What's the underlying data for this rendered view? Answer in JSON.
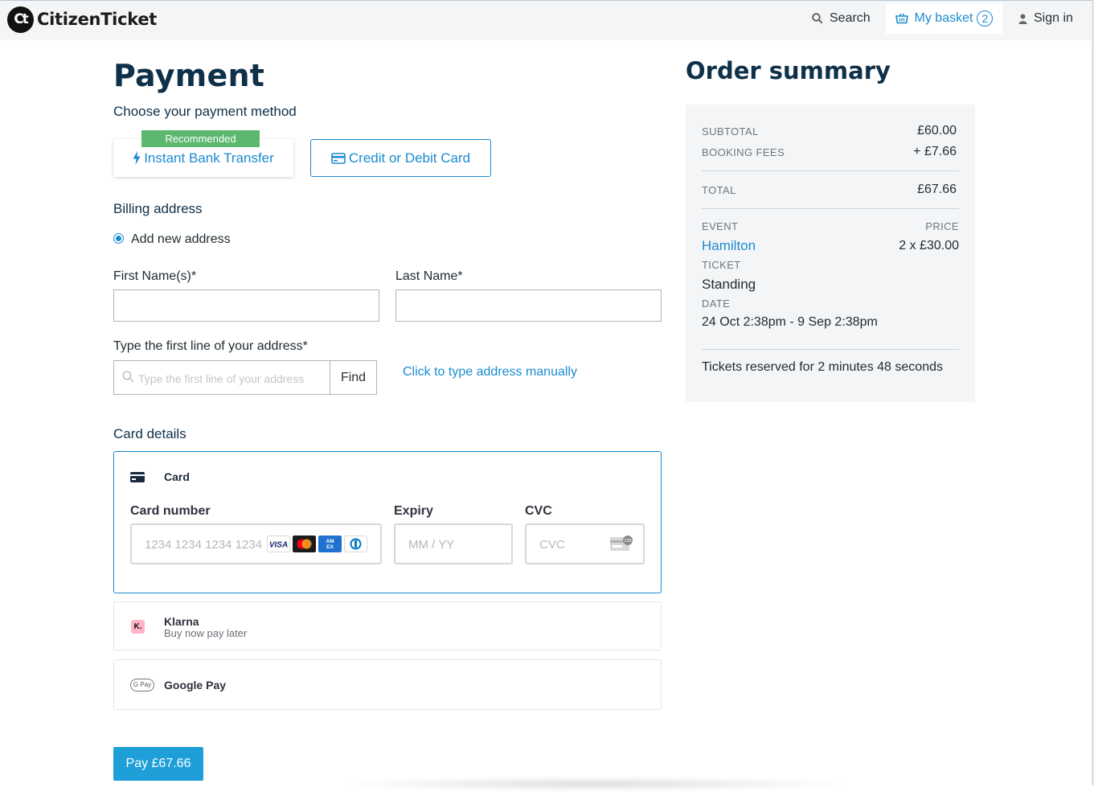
{
  "header": {
    "logo_mark": "Ct",
    "logo_text": "CitizenTicket",
    "search_label": "Search",
    "basket_label": "My basket",
    "basket_count": "2",
    "signin_label": "Sign in"
  },
  "payment": {
    "title": "Payment",
    "choose_method": "Choose your payment method",
    "recommended_badge": "Recommended",
    "bank_transfer_label": "Instant Bank Transfer",
    "card_label": "Credit or Debit Card"
  },
  "billing": {
    "heading": "Billing address",
    "radio_label": "Add new address",
    "first_name_label": "First Name(s)*",
    "last_name_label": "Last Name*",
    "address_label": "Type the first line of your address*",
    "address_placeholder": "Type the first line of your address",
    "find_label": "Find",
    "manual_link": "Click to type address manually"
  },
  "card_details": {
    "heading": "Card details",
    "card_tab": "Card",
    "number_label": "Card number",
    "number_placeholder": "1234 1234 1234 1234",
    "expiry_label": "Expiry",
    "expiry_placeholder": "MM / YY",
    "cvc_label": "CVC",
    "cvc_placeholder": "CVC",
    "cvc_icon_text": "135",
    "brands": [
      "VISA",
      "Mastercard",
      "AMEX",
      "Diners"
    ],
    "klarna_name": "Klarna",
    "klarna_sub": "Buy now pay later",
    "klarna_icon": "K.",
    "gpay_name": "Google Pay",
    "gpay_icon": "G Pay"
  },
  "pay_button": "Pay £67.66",
  "summary": {
    "title": "Order summary",
    "subtotal_label": "SUBTOTAL",
    "subtotal_value": "£60.00",
    "fees_label": "BOOKING FEES",
    "fees_value": "+ £7.66",
    "total_label": "TOTAL",
    "total_value": "£67.66",
    "event_label": "EVENT",
    "price_label": "PRICE",
    "event_name": "Hamilton",
    "price_value": "2 x £30.00",
    "ticket_label": "TICKET",
    "ticket_value": "Standing",
    "date_label": "DATE",
    "date_value": "24 Oct 2:38pm - 9 Sep 2:38pm",
    "reserved_text": "Tickets reserved for 2 minutes 48 seconds"
  },
  "colors": {
    "accent": "#1b8bd0",
    "heading": "#0f3049",
    "recommended": "#5cb86f",
    "pay_button": "#1e9fd8"
  }
}
